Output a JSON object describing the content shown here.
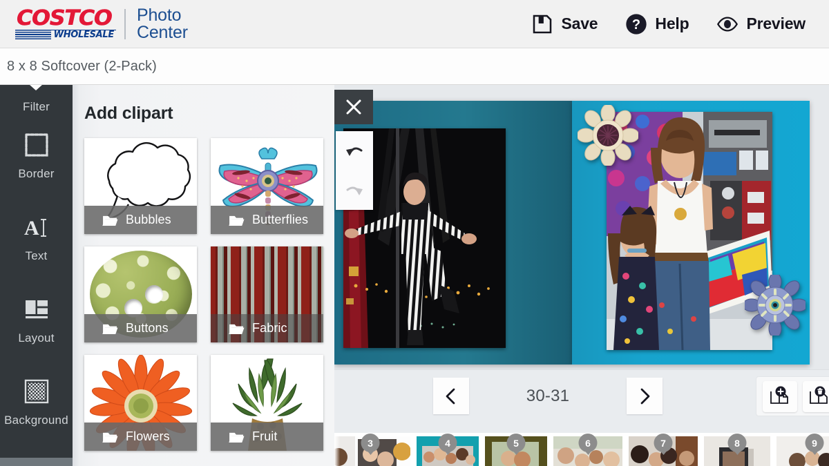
{
  "header": {
    "brand": {
      "costco_word": "COSTCO",
      "costco_sub": "WHOLESALE",
      "photo_line1": "Photo",
      "photo_line2": "Center"
    },
    "actions": [
      {
        "label": "Save",
        "icon": "save-floppy-icon"
      },
      {
        "label": "Help",
        "icon": "help-circle-icon"
      },
      {
        "label": "Preview",
        "icon": "eye-icon"
      }
    ]
  },
  "titlebar": {
    "product": "8 x 8 Softcover (2-Pack)"
  },
  "sidebar": {
    "items": [
      {
        "label": "Filter",
        "icon": "filter-icon",
        "selected": true
      },
      {
        "label": "Border",
        "icon": "border-icon",
        "selected": false
      },
      {
        "label": "Text",
        "icon": "text-icon",
        "selected": false
      },
      {
        "label": "Layout",
        "icon": "layout-icon",
        "selected": false
      },
      {
        "label": "Background",
        "icon": "background-icon",
        "selected": false
      }
    ]
  },
  "clipart_panel": {
    "title": "Add clipart",
    "close_label": "Close",
    "categories": [
      {
        "label": "Bubbles",
        "thumb": "speech-bubble-cloud"
      },
      {
        "label": "Butterflies",
        "thumb": "beaded-dragonfly"
      },
      {
        "label": "Buttons",
        "thumb": "green-polkadot-button"
      },
      {
        "label": "Fabric",
        "thumb": "red-striped-fabric"
      },
      {
        "label": "Flowers",
        "thumb": "orange-gerbera-daisy"
      },
      {
        "label": "Fruit",
        "thumb": "pineapple-top"
      }
    ]
  },
  "editor": {
    "undo_label": "Undo",
    "redo_label": "Redo",
    "undo_enabled": true,
    "redo_enabled": false,
    "spread": {
      "left_page_bg_color": "#1d6c85",
      "right_page_bg_color": "#13a7d2",
      "left_photo_alt": "Aerial silk performer in black and white striped costume at night",
      "right_photo_alt": "Woman and girl holding a colorful abstract painting",
      "cliparts": [
        "cream-wood-flower",
        "blue-layered-flower"
      ]
    }
  },
  "page_nav": {
    "prev_label": "Previous pages",
    "next_label": "Next pages",
    "page_range": "30-31",
    "add_page_label": "Add page",
    "delete_page_label": "Delete page"
  },
  "filmstrip": {
    "items": [
      {
        "number": "3"
      },
      {
        "number": "4"
      },
      {
        "number": "5"
      },
      {
        "number": "6"
      },
      {
        "number": "7"
      },
      {
        "number": "8"
      },
      {
        "number": "9"
      }
    ]
  },
  "colors": {
    "brand_red": "#e31837",
    "brand_blue": "#1d4f91",
    "sidebar_dark": "#32373b",
    "canvas_bg": "#e6e9ec",
    "page_teal": "#13a7d2"
  }
}
